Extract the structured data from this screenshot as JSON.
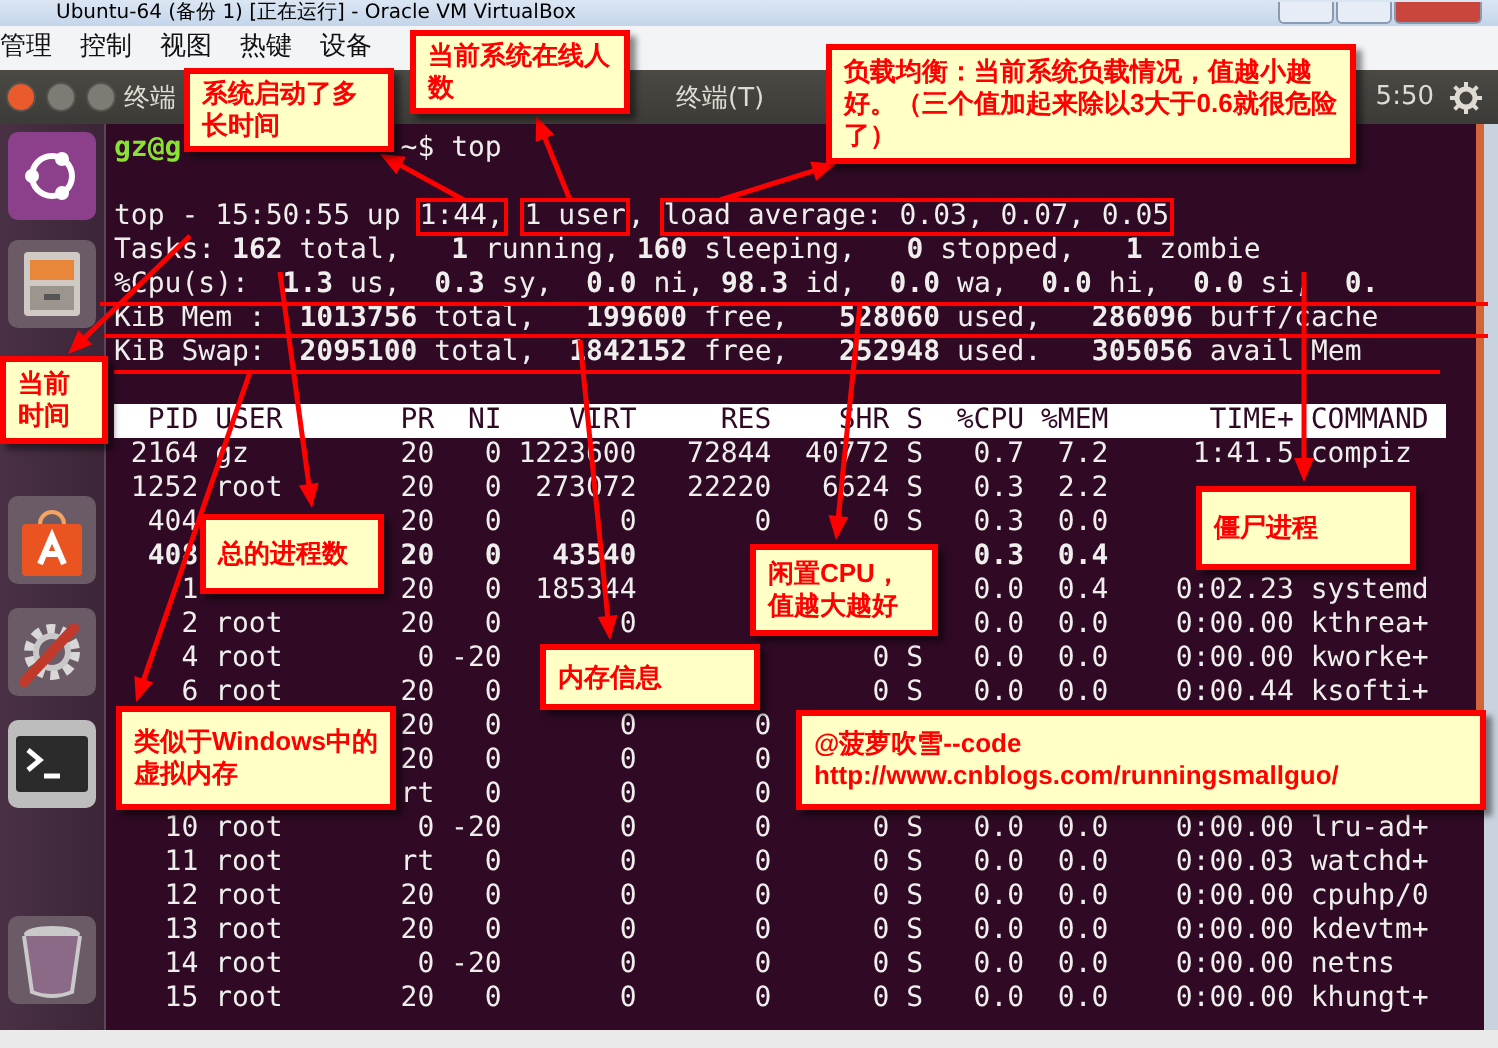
{
  "window": {
    "title": "Ubuntu-64 (备份 1) [正在运行] - Oracle VM VirtualBox"
  },
  "menu": [
    "管理",
    "控制",
    "视图",
    "热键",
    "设备"
  ],
  "panel": {
    "app_name": "终端",
    "menu_item": "终端(T)",
    "clock": "5:50"
  },
  "terminal": {
    "prompt": [
      {
        "text": "gz@g",
        "kind": "host"
      },
      {
        "text": "~$ top",
        "kind": "plain"
      }
    ],
    "uptime_line": [
      {
        "text": "top - 15:50:55 up",
        "boxed": false
      },
      {
        "text": "1:44,",
        "boxed": true
      },
      {
        "text": "1 user",
        "boxed": true
      },
      {
        "text": ",",
        "boxed": false
      },
      {
        "text": "load average: 0.03, 0.07, 0.05",
        "boxed": true
      }
    ],
    "summary_lines": [
      "Tasks: **162** total,   **1** running, **160** sleeping,   **0** stopped,   **1** zombie",
      "%Cpu(s):  **1.3** us,  **0.3** sy,  **0.0** ni, **98.3** id,  **0.0** wa,  **0.0** hi,  **0.0** si,  **0.**",
      "KiB Mem :  **1013756** total,   **199600** free,   **528060** used,   **286096** buff/cache",
      "KiB Swap:  **2095100** total,  **1842152** free,   **252948** used.   **305056** avail Mem"
    ],
    "table": {
      "columns": [
        "PID",
        "USER",
        "PR",
        "NI",
        "VIRT",
        "RES",
        "SHR",
        "S",
        "%CPU",
        "%MEM",
        "TIME+",
        "COMMAND"
      ],
      "rows": [
        {
          "pid": "2164",
          "user": "gz",
          "pr": "20",
          "ni": "0",
          "virt": "1223600",
          "res": "72844",
          "shr": "40772",
          "s": "S",
          "cpu": "0.7",
          "mem": "7.2",
          "time": "1:41.5",
          "command": "compiz",
          "bold": false
        },
        {
          "pid": "1252",
          "user": "root",
          "pr": "20",
          "ni": "0",
          "virt": "273072",
          "res": "22220",
          "shr": "6624",
          "s": "S",
          "cpu": "0.3",
          "mem": "2.2",
          "bold": false
        },
        {
          "pid": "404",
          "pr": "20",
          "ni": "0",
          "virt": "0",
          "res": "0",
          "shr": "0",
          "s": "S",
          "cpu": "0.3",
          "mem": "0.0",
          "bold": false
        },
        {
          "pid": "408",
          "pr": "20",
          "ni": "0",
          "virt": "43540",
          "cpu": "0.3",
          "mem": "0.4",
          "bold": true
        },
        {
          "pid": "1",
          "pr": "20",
          "ni": "0",
          "virt": "185344",
          "cpu": "0.0",
          "mem": "0.4",
          "time": "0:02.23",
          "command": "systemd",
          "bold": false
        },
        {
          "pid": "2",
          "user": "root",
          "pr": "20",
          "ni": "0",
          "virt": "0",
          "cpu": "0.0",
          "mem": "0.0",
          "time": "0:00.00",
          "command": "kthrea+",
          "bold": false
        },
        {
          "pid": "4",
          "user": "root",
          "pr": "0",
          "ni": "-20",
          "shr": "0",
          "s": "S",
          "cpu": "0.0",
          "mem": "0.0",
          "time": "0:00.00",
          "command": "kworke+",
          "bold": false
        },
        {
          "pid": "6",
          "user": "root",
          "pr": "20",
          "ni": "0",
          "shr": "0",
          "s": "S",
          "cpu": "0.0",
          "mem": "0.0",
          "time": "0:00.44",
          "command": "ksofti+",
          "bold": false
        },
        {
          "pr": "20",
          "ni": "0",
          "virt": "0",
          "res": "0",
          "bold": false
        },
        {
          "pr": "20",
          "ni": "0",
          "virt": "0",
          "res": "0",
          "bold": false
        },
        {
          "pr": "rt",
          "ni": "0",
          "virt": "0",
          "res": "0",
          "bold": false
        },
        {
          "pid": "10",
          "user": "root",
          "pr": "0",
          "ni": "-20",
          "virt": "0",
          "res": "0",
          "shr": "0",
          "s": "S",
          "cpu": "0.0",
          "mem": "0.0",
          "time": "0:00.00",
          "command": "lru-ad+",
          "bold": false
        },
        {
          "pid": "11",
          "user": "root",
          "pr": "rt",
          "ni": "0",
          "virt": "0",
          "res": "0",
          "shr": "0",
          "s": "S",
          "cpu": "0.0",
          "mem": "0.0",
          "time": "0:00.03",
          "command": "watchd+",
          "bold": false
        },
        {
          "pid": "12",
          "user": "root",
          "pr": "20",
          "ni": "0",
          "virt": "0",
          "res": "0",
          "shr": "0",
          "s": "S",
          "cpu": "0.0",
          "mem": "0.0",
          "time": "0:00.00",
          "command": "cpuhp/0",
          "bold": false
        },
        {
          "pid": "13",
          "user": "root",
          "pr": "20",
          "ni": "0",
          "virt": "0",
          "res": "0",
          "shr": "0",
          "s": "S",
          "cpu": "0.0",
          "mem": "0.0",
          "time": "0:00.00",
          "command": "kdevtm+",
          "bold": false
        },
        {
          "pid": "14",
          "user": "root",
          "pr": "0",
          "ni": "-20",
          "virt": "0",
          "res": "0",
          "shr": "0",
          "s": "S",
          "cpu": "0.0",
          "mem": "0.0",
          "time": "0:00.00",
          "command": "netns",
          "bold": false
        },
        {
          "pid": "15",
          "user": "root",
          "pr": "20",
          "ni": "0",
          "virt": "0",
          "res": "0",
          "shr": "0",
          "s": "S",
          "cpu": "0.0",
          "mem": "0.0",
          "time": "0:00.00",
          "command": "khungt+",
          "bold": false
        }
      ]
    }
  },
  "callouts": [
    {
      "lines": [
        "系统启动了多长时间"
      ]
    },
    {
      "lines": [
        "当前系统在线人数"
      ]
    },
    {
      "lines": [
        "负载均衡：当前系统负载情况，值越小越好。（三个值加起来除以3大于0.6就很危险了）"
      ]
    },
    {
      "lines": [
        "当前时间"
      ]
    },
    {
      "lines": [
        "总的进程数"
      ]
    },
    {
      "lines": [
        "僵尸进程"
      ]
    },
    {
      "lines": [
        "闲置CPU，",
        "值越大越好"
      ]
    },
    {
      "lines": [
        "内存信息"
      ]
    },
    {
      "lines": [
        "类似于Windows中的",
        "虚拟内存"
      ]
    },
    {
      "lines": [
        "@菠萝吹雪--code",
        "http://www.cnblogs.com/runningsmallguo/"
      ]
    }
  ]
}
